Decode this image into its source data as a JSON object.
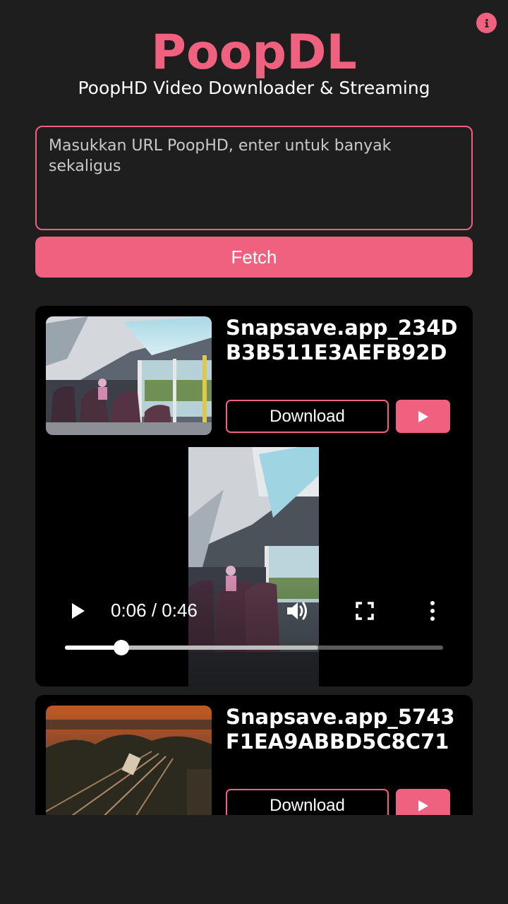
{
  "header": {
    "title": "PoopDL",
    "subtitle": "PoopHD Video Downloader & Streaming",
    "info_icon": "info-icon"
  },
  "form": {
    "url_placeholder": "Masukkan URL PoopHD, enter untuk banyak sekaligus",
    "url_value": "",
    "fetch_label": "Fetch"
  },
  "videos": [
    {
      "title": "Snapsave.app_234DB3B511E3AEFB92D",
      "download_label": "Download",
      "play_icon": "play-icon",
      "player": {
        "time": "0:06 / 0:46",
        "progress": 0.15,
        "buffered": 0.67,
        "icons": [
          "play-icon",
          "volume-icon",
          "fullscreen-icon",
          "more-vert-icon"
        ]
      }
    },
    {
      "title": "Snapsave.app_5743F1EA9ABBD5C8C71",
      "download_label": "Download",
      "play_icon": "play-icon"
    }
  ],
  "colors": {
    "accent": "#f0607f",
    "background": "#1e1e1e",
    "card": "#000000"
  }
}
